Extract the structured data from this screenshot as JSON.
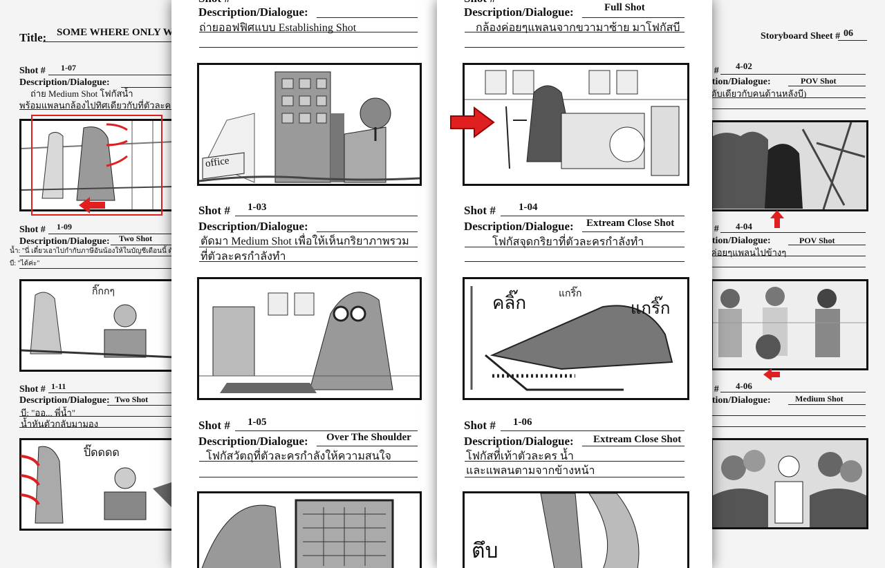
{
  "left_sheet": {
    "title_label": "Title:",
    "title_value": "SOME WHERE ONLY W",
    "panels": [
      {
        "shot_label": "Shot #",
        "shot": "1-07",
        "desc_label": "Description/Dialogue:",
        "desc_value": "",
        "lines": [
          "ถ่าย Medium Shot โฟกัสน้ำ",
          "พร้อมแพลนกล้องไปทิศเดียวกับที่ตัวละครเดิ"
        ]
      },
      {
        "shot_label": "Shot #",
        "shot": "1-09",
        "desc_label": "Description/Dialogue:",
        "desc_value": "Two Shot",
        "lines": [
          "น้ำ: \"นี่ เดี๋ยวเอาไปกำกับภาษีอันน้องให้ในบัญชีเดือนนี้ ด้วยนะ",
          "บี: \"ได้ค่ะ\""
        ],
        "sketch_text": "กิ๊กกๆ"
      },
      {
        "shot_label": "Shot #",
        "shot": "1-11",
        "desc_label": "Description/Dialogue:",
        "desc_value": "Two Shot",
        "lines": [
          "บี: \"ออ... พี่น้ำ\"",
          "น้ำหันตัวกลับมามอง"
        ],
        "sketch_text": "ปิ๊ดดดด"
      }
    ]
  },
  "middle_sheet": {
    "panels": [
      {
        "shot_label": "Shot #",
        "shot": "",
        "desc_label": "Description/Dialogue:",
        "desc_value": "",
        "lines": [
          "ถ่ายออฟฟิศแบบ Establishing Shot",
          ""
        ],
        "sketch_text": "office"
      },
      {
        "shot_label": "Shot #",
        "shot": "1-03",
        "desc_label": "Description/Dialogue:",
        "desc_value": "",
        "lines": [
          "ตัดมา Medium Shot เพื่อให้เห็นกริยาภาพรวม",
          "ที่ตัวละครกำลังทำ"
        ]
      },
      {
        "shot_label": "Shot #",
        "shot": "1-05",
        "desc_label": "Description/Dialogue:",
        "desc_value": "Over The Shoulder",
        "lines": [
          "โฟกัสวัตถุที่ตัวละครกำลังให้ความสนใจ",
          ""
        ]
      }
    ]
  },
  "right_sheet": {
    "panels": [
      {
        "shot_label": "Shot #",
        "shot": "",
        "desc_label": "Description/Dialogue:",
        "desc_value": "Full Shot",
        "lines": [
          "กล้องค่อยๆแพลนจากขวามาซ้าย มาโฟกัสบี",
          ""
        ]
      },
      {
        "shot_label": "Shot #",
        "shot": "1-04",
        "desc_label": "Description/Dialogue:",
        "desc_value": "Extream Close Shot",
        "lines": [
          "โฟกัสจุดกริยาที่ตัวละครกำลังทำ",
          ""
        ],
        "sketch_text_1": "คลิ๊ก",
        "sketch_text_2": "แกริ๊ก",
        "sketch_text_3": "แกริ๊ก"
      },
      {
        "shot_label": "Shot #",
        "shot": "1-06",
        "desc_label": "Description/Dialogue:",
        "desc_value": "Extream Close Shot",
        "lines": [
          "โฟกัสที่เท้าตัวละคร น้ำ",
          "และแพลนตามจากข้างหน้า"
        ],
        "sketch_text": "ตึบ"
      }
    ]
  },
  "far_right_sheet": {
    "sheet_label": "Storyboard Sheet #",
    "sheet_number": "06",
    "panels": [
      {
        "shot_label": "Shot #",
        "shot": "4-02",
        "desc_label": "Description/Dialogue:",
        "desc_value": "POV Shot",
        "lines": [
          "ดับเดียวกับคนด้านหลังบี)"
        ]
      },
      {
        "shot_label": "Shot #",
        "shot": "4-04",
        "desc_label": "Description/Dialogue:",
        "desc_value": "POV Shot",
        "lines": [
          "ค่อยๆแพลนไปข้างๆ"
        ]
      },
      {
        "shot_label": "Shot #",
        "shot": "4-06",
        "desc_label": "Description/Dialogue:",
        "desc_value": "Medium Shot",
        "lines": [
          ""
        ]
      }
    ]
  },
  "colors": {
    "annotation_red": "#e02020",
    "ink": "#111111"
  }
}
